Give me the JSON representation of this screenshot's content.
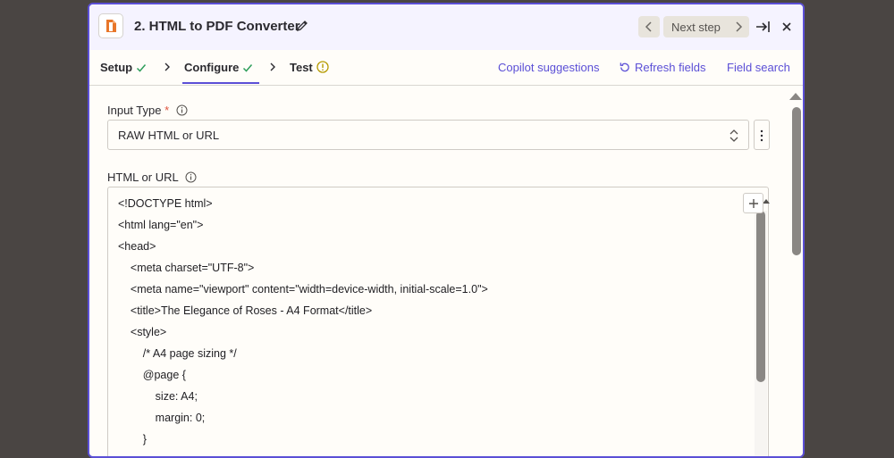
{
  "header": {
    "step_title": "2. HTML to PDF Converter",
    "app_icon": "document-app-icon",
    "next_label": "Next step"
  },
  "tabs": [
    {
      "label": "Setup",
      "status": "complete"
    },
    {
      "label": "Configure",
      "status": "complete"
    },
    {
      "label": "Test",
      "status": "warning"
    }
  ],
  "links": {
    "copilot": "Copilot suggestions",
    "refresh": "Refresh fields",
    "field_search": "Field search"
  },
  "fields": {
    "input_type": {
      "label": "Input Type",
      "required_mark": "*",
      "value": "RAW HTML or URL"
    },
    "html_or_url": {
      "label": "HTML or URL",
      "lines": [
        "<!DOCTYPE html>",
        "<html lang=\"en\">",
        "<head>",
        "    <meta charset=\"UTF-8\">",
        "    <meta name=\"viewport\" content=\"width=device-width, initial-scale=1.0\">",
        "    <title>The Elegance of Roses - A4 Format</title>",
        "    <style>",
        "        /* A4 page sizing */",
        "        @page {",
        "            size: A4;",
        "            margin: 0;",
        "        }"
      ]
    }
  },
  "colors": {
    "accent": "#5b4fd6",
    "success": "#2e9e5b",
    "warning": "#b59a00",
    "required": "#e0533d"
  }
}
